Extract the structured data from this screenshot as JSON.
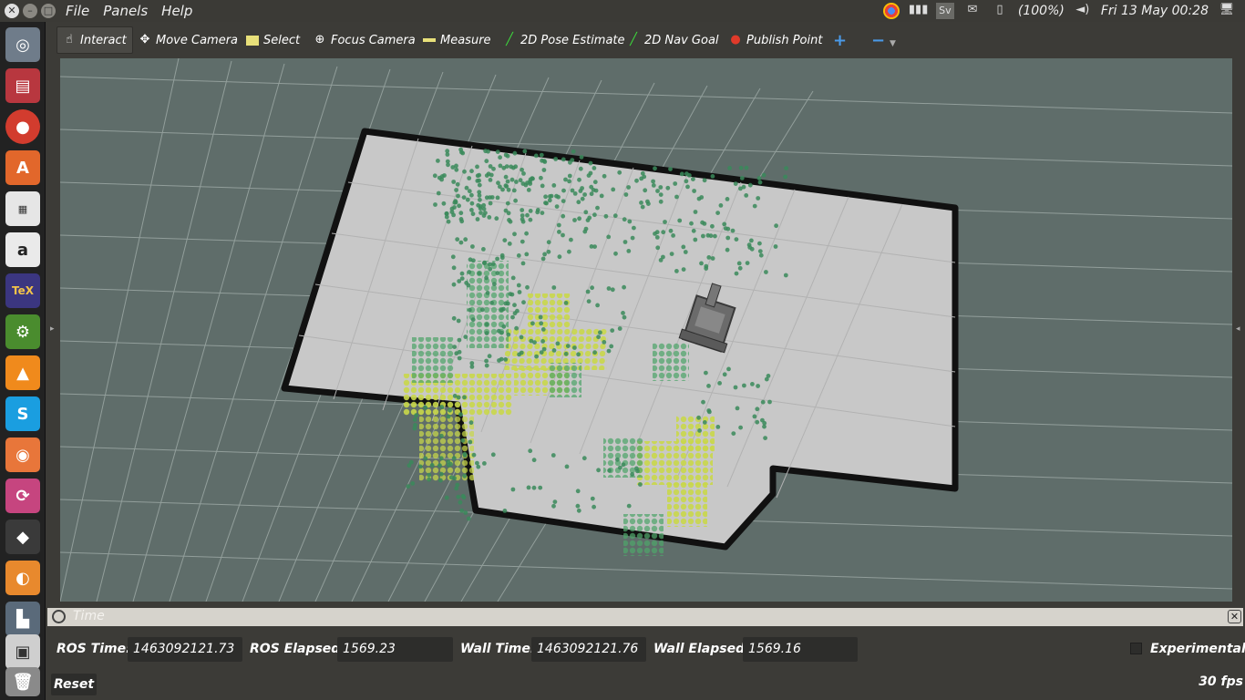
{
  "menubar": {
    "menus": [
      "File",
      "Panels",
      "Help"
    ],
    "battery": "(100%)",
    "clock": "Fri 13 May 00:28",
    "keyboard": "Sv"
  },
  "toolbar": {
    "tools": [
      {
        "label": "Interact",
        "icon": "hand-icon",
        "active": true
      },
      {
        "label": "Move Camera",
        "icon": "move-icon"
      },
      {
        "label": "Select",
        "icon": "select-icon"
      },
      {
        "label": "Focus Camera",
        "icon": "crosshair-icon"
      },
      {
        "label": "Measure",
        "icon": "ruler-icon"
      },
      {
        "label": "2D Pose Estimate",
        "icon": "pose-arrow-icon"
      },
      {
        "label": "2D Nav Goal",
        "icon": "goal-arrow-icon"
      },
      {
        "label": "Publish Point",
        "icon": "pin-icon"
      }
    ],
    "add": "+",
    "remove": "−"
  },
  "launcher": {
    "apps": [
      "ubuntu-dash-icon",
      "files-icon",
      "chrome-icon",
      "software-center-icon",
      "libreoffice-icon",
      "amazon-icon",
      "texmaker-icon",
      "search-tool-icon",
      "vlc-icon",
      "skype-icon",
      "app-orange-icon",
      "app-pink-icon",
      "inkscape-icon",
      "blender-icon",
      "system-monitor-icon",
      "rviz-icon",
      "trash-icon"
    ]
  },
  "time_panel": {
    "title": "Time",
    "ros_time_label": "ROS Time:",
    "ros_time": "1463092121.73",
    "ros_elapsed_label": "ROS Elapsed:",
    "ros_elapsed": "1569.23",
    "wall_time_label": "Wall Time:",
    "wall_time": "1463092121.76",
    "wall_elapsed_label": "Wall Elapsed:",
    "wall_elapsed": "1569.16",
    "experimental_label": "Experimental",
    "reset_label": "Reset",
    "fps": "30 fps"
  },
  "colors": {
    "background": "#5f6d6a",
    "map_free": "#c8c8c8",
    "obstacle": "#000000",
    "cloud_green": "#3a8a5a",
    "cost_yellow": "#e6ea60",
    "grid": "#a8b4b0"
  }
}
